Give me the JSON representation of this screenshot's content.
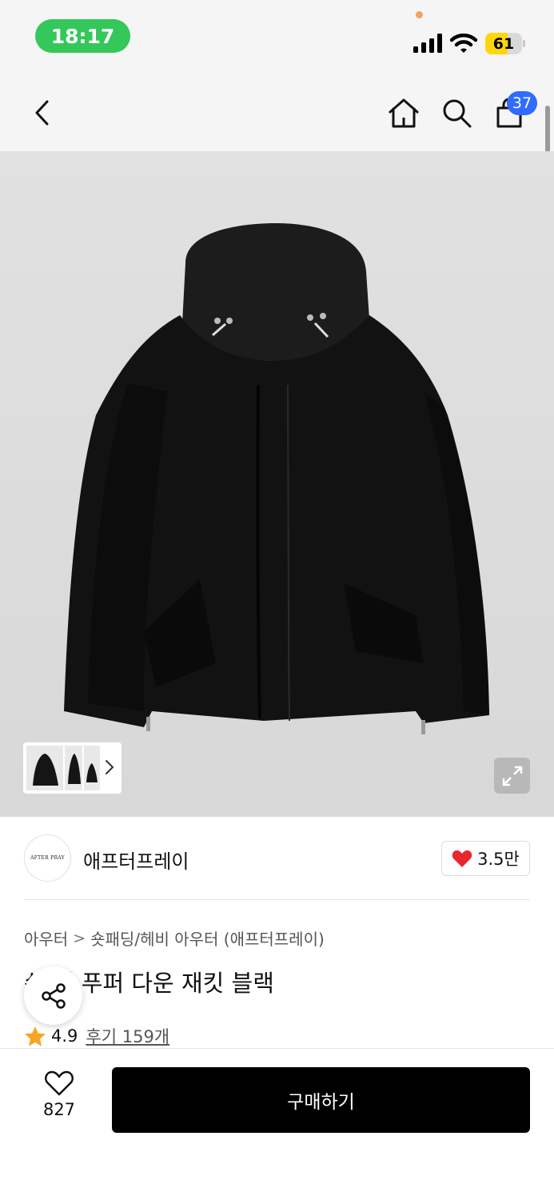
{
  "status_bar": {
    "time": "18:17",
    "battery_level": "61",
    "battery_fraction": 0.61,
    "colors": {
      "time_pill": "#34c759",
      "battery": "#ffd60a"
    }
  },
  "nav": {
    "icons": [
      "chevron-left-icon",
      "home-icon",
      "search-icon",
      "shopping-bag-icon"
    ],
    "cart_count": "37",
    "badge_color": "#2f6bff"
  },
  "gallery": {
    "thumbnail_count": 3,
    "icons": [
      "chevron-right-icon",
      "expand-icon"
    ]
  },
  "brand": {
    "logo_text": "AFTER PRAY",
    "name": "애프터프레이",
    "like_count": "3.5만",
    "like_color": "#e8262e"
  },
  "breadcrumb": {
    "level1": "아우터",
    "level2": "숏패딩/헤비 아우터 (애프터프레이)"
  },
  "product": {
    "title": "쉬 디 푸퍼 다운 재킷 블랙",
    "rating": "4.9",
    "reviews": "후기 159개",
    "star_color": "#f5a623"
  },
  "bottom_bar": {
    "wish_count": "827",
    "buy_label": "구매하기"
  }
}
